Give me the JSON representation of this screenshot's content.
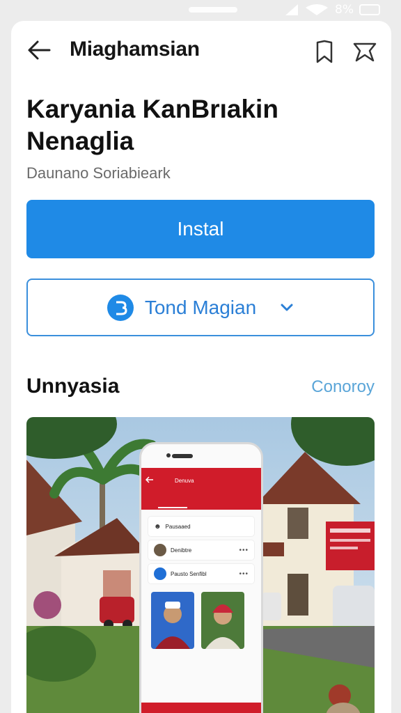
{
  "status_bar": {
    "battery": "8%"
  },
  "app_bar": {
    "title": "Miaghamsian",
    "back_icon": "arrow-left-icon",
    "bookmark_icon": "bookmark-icon",
    "star_icon": "star-icon"
  },
  "app": {
    "name": "Karyania KanBrıakin Nenaglia",
    "developer": "Daunano Soriabieark"
  },
  "buttons": {
    "install_label": "Instal",
    "tour_label": "Tond Magian",
    "tour_logo_icon": "brand-logo-icon",
    "tour_chevron_icon": "chevron-down-icon"
  },
  "section": {
    "title": "Unnyasia",
    "link": "Conoroy"
  },
  "preview": {
    "header_title": "Denuva",
    "rows": [
      "Pausaaed",
      "Denibtre",
      "Pausto Senfibl"
    ]
  },
  "colors": {
    "accent": "#1f8ae6",
    "app_header_red": "#d01c2a"
  }
}
